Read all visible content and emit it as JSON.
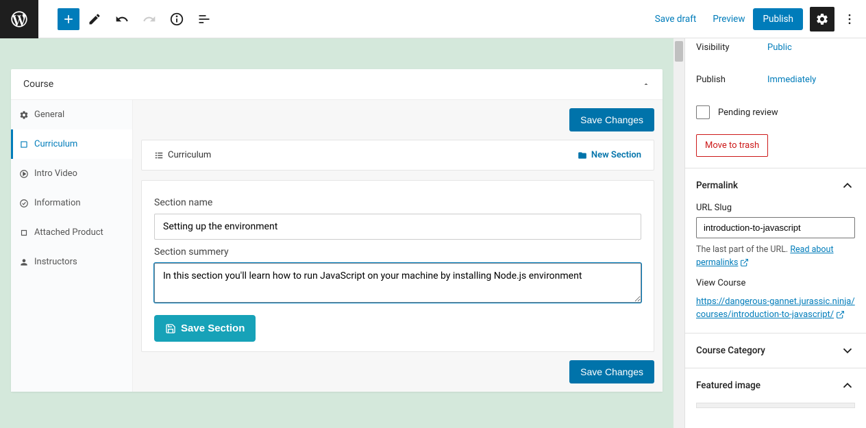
{
  "topbar": {
    "save_draft": "Save draft",
    "preview": "Preview",
    "publish": "Publish"
  },
  "course": {
    "title": "Course",
    "nav": {
      "general": "General",
      "curriculum": "Curriculum",
      "intro_video": "Intro Video",
      "information": "Information",
      "attached_product": "Attached Product",
      "instructors": "Instructors"
    },
    "save_changes": "Save Changes",
    "curriculum_label": "Curriculum",
    "new_section": "New Section",
    "section_name_label": "Section name",
    "section_name_value": "Setting up the environment",
    "section_summary_label": "Section summery",
    "section_summary_value": "In this section you'll learn how to run JavaScript on your machine by installing Node.js environment",
    "save_section": "Save Section"
  },
  "sidebar": {
    "visibility_label": "Visibility",
    "visibility_value": "Public",
    "publish_label": "Publish",
    "publish_value": "Immediately",
    "pending_review": "Pending review",
    "move_to_trash": "Move to trash",
    "permalink": {
      "title": "Permalink",
      "url_slug_label": "URL Slug",
      "url_slug_value": "introduction-to-javascript",
      "help_text_prefix": "The last part of the URL. ",
      "help_link": "Read about permalinks",
      "view_course": "View Course",
      "course_url": "https://dangerous-gannet.jurassic.ninja/courses/introduction-to-javascript/"
    },
    "course_category": "Course Category",
    "featured_image": "Featured image"
  }
}
